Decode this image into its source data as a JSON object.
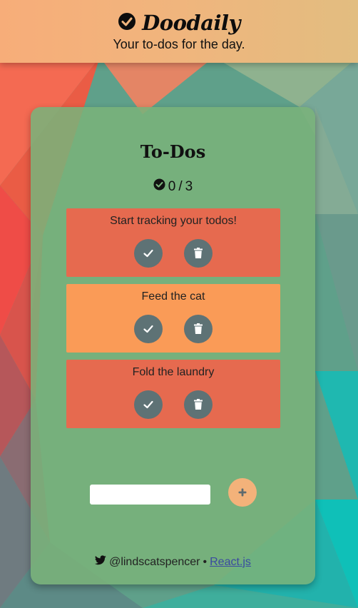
{
  "header": {
    "title": "Doodaily",
    "tagline": "Your to-dos for the day.",
    "logo_icon": "check-circle-icon"
  },
  "card": {
    "title": "To-Dos",
    "counter": {
      "done": "0",
      "separator": "/",
      "total": "3",
      "icon": "check-circle-icon"
    },
    "todos": [
      {
        "text": "Start tracking your todos!",
        "color": "#e66a4f"
      },
      {
        "text": "Feed the cat",
        "color": "#fa9b57"
      },
      {
        "text": "Fold the laundry",
        "color": "#e66a4f"
      }
    ],
    "new_todo": {
      "value": "",
      "placeholder": ""
    },
    "add_icon": "plus-icon"
  },
  "footer": {
    "icon": "twitter-icon",
    "handle": "@lindscatspencer",
    "separator": "•",
    "link_text": "React.js"
  },
  "colors": {
    "header": "#f0b57d",
    "card": "#7ab27a",
    "todo_red": "#e66a4f",
    "todo_orange": "#fa9b57",
    "action_button": "#5e7275",
    "add_button": "#f3b27a"
  }
}
